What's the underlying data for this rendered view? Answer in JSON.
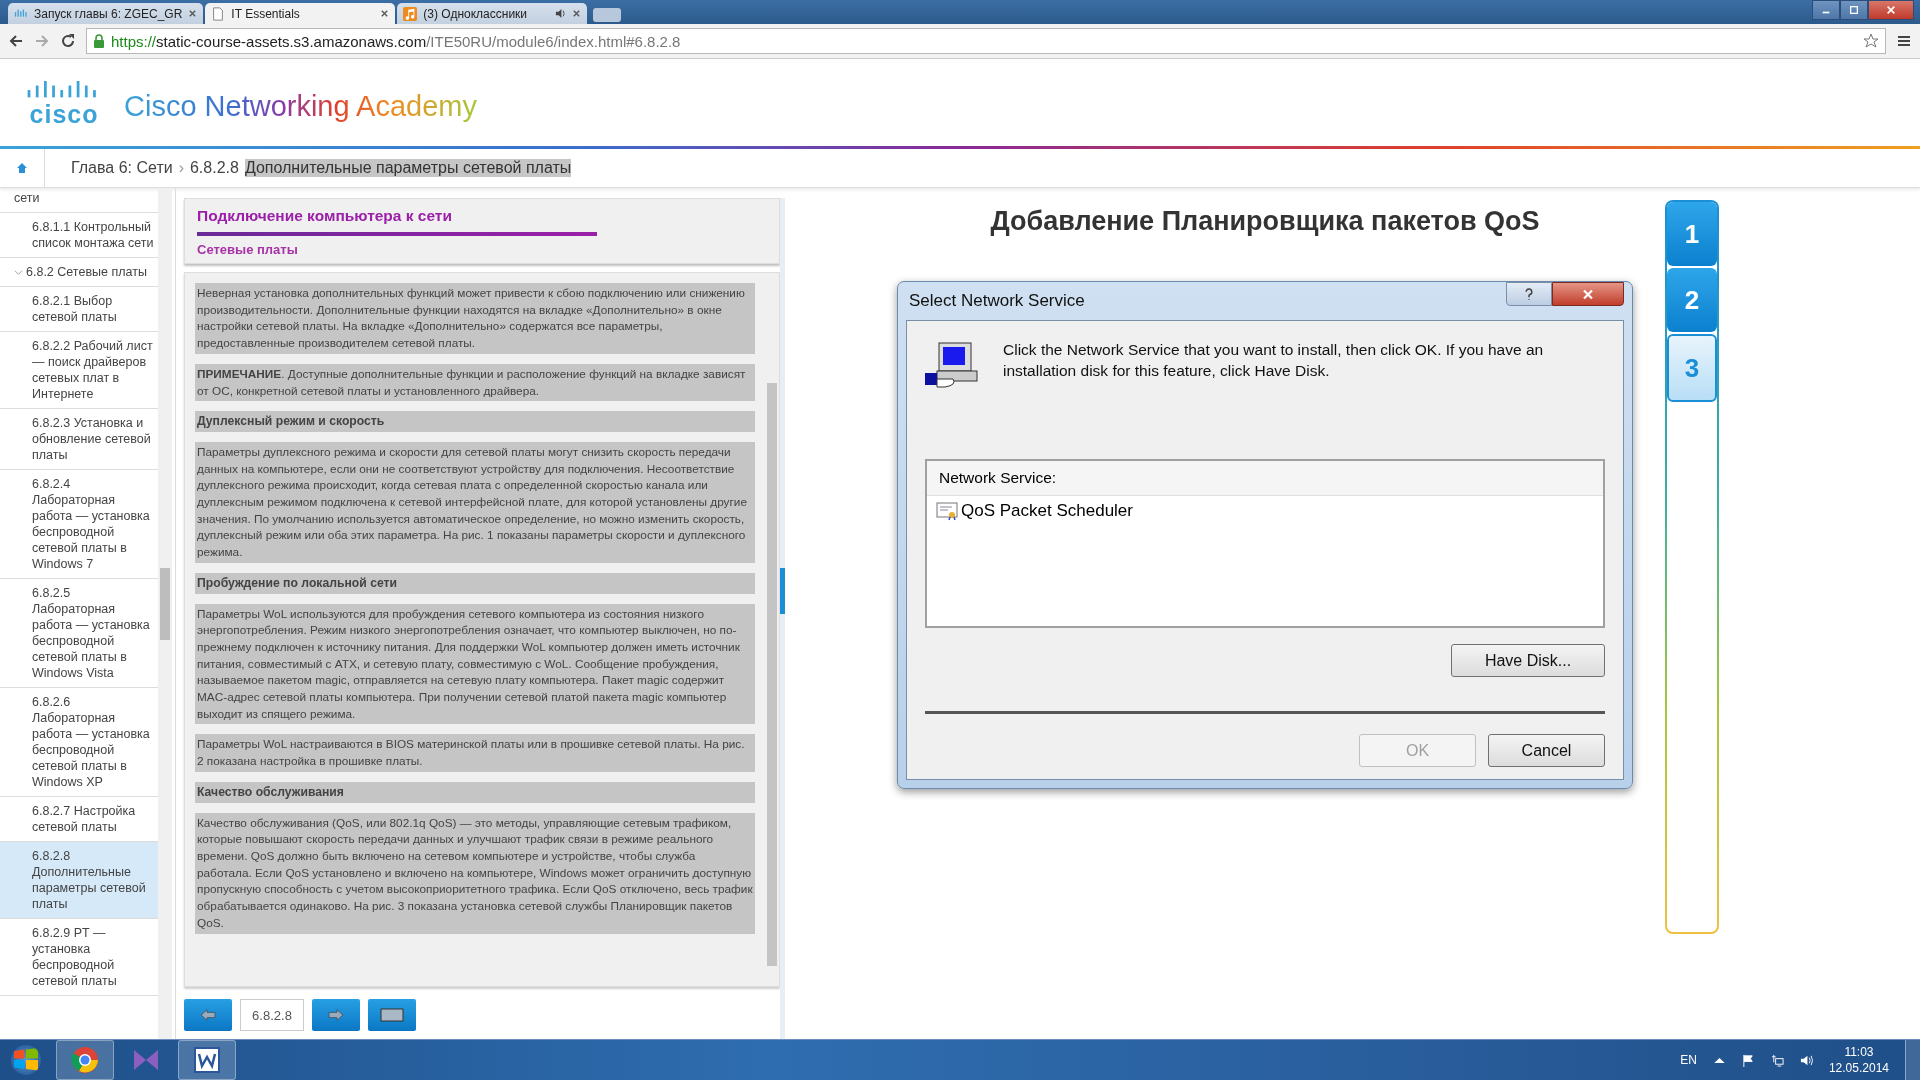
{
  "browser": {
    "tabs": [
      {
        "title": "Запуск главы 6: ZGEC_GR",
        "selected": false,
        "kind": "cisco",
        "audio": false
      },
      {
        "title": "IT Essentials",
        "selected": true,
        "kind": "page",
        "audio": false
      },
      {
        "title": "(3) Одноклассники",
        "selected": false,
        "kind": "music",
        "audio": true
      }
    ],
    "url_secure": "https://",
    "url_host": "static-course-assets.s3.amazonaws.com",
    "url_path": "/ITE50RU/module6/index.html#6.8.2.8"
  },
  "header": {
    "logo_wordmark": "cisco",
    "brand": "Cisco Networking Academy"
  },
  "breadcrumb": {
    "items": [
      {
        "label": "Глава 6: Сети",
        "highlighted": false
      },
      {
        "label": "6.8.2.8",
        "highlighted": false
      },
      {
        "label": "Дополнительные параметры сетевой платы",
        "highlighted": true
      }
    ],
    "separator": "›"
  },
  "sidebar": {
    "items": [
      {
        "label": "сети",
        "selected": false,
        "children": [
          {
            "label": "6.8.1.1 Контрольный список монтажа сети",
            "selected": false
          }
        ]
      },
      {
        "label": "6.8.2 Сетевые платы",
        "selected": false,
        "expanded": true,
        "children": [
          {
            "label": "6.8.2.1 Выбор сетевой платы",
            "selected": false
          },
          {
            "label": "6.8.2.2 Рабочий лист — поиск драйверов сетевых плат в Интернете",
            "selected": false
          },
          {
            "label": "6.8.2.3 Установка и обновление сетевой платы",
            "selected": false
          },
          {
            "label": "6.8.2.4 Лабораторная работа — установка беспроводной сетевой платы в Windows 7",
            "selected": false
          },
          {
            "label": "6.8.2.5 Лабораторная работа — установка беспроводной сетевой платы в Windows Vista",
            "selected": false
          },
          {
            "label": "6.8.2.6 Лабораторная работа — установка беспроводной сетевой платы в Windows XP",
            "selected": false
          },
          {
            "label": "6.8.2.7 Настройка сетевой платы",
            "selected": false
          },
          {
            "label": "6.8.2.8 Дополнительные параметры сетевой платы",
            "selected": true
          },
          {
            "label": "6.8.2.9 PT — установка беспроводной сетевой платы",
            "selected": false
          }
        ]
      }
    ]
  },
  "lesson": {
    "title": "Подключение компьютера к сети",
    "subtitle": "Сетевые платы",
    "blocks": [
      {
        "kind": "paragraph",
        "text": "Неверная установка дополнительных функций может привести к сбою подключению или снижению производительности. Дополнительные функции находятся на вкладке «Дополнительно» в окне настройки сетевой платы. На вкладке «Дополнительно» содержатся все параметры, предоставленные производителем сетевой платы."
      },
      {
        "kind": "paragraph",
        "text": "**ПРИМЕЧАНИЕ**. Доступные дополнительные функции и расположение функций на вкладке зависят от ОС, конкретной сетевой платы и установленного драйвера."
      },
      {
        "kind": "heading",
        "text": "Дуплексный режим и скорость"
      },
      {
        "kind": "paragraph",
        "text": "Параметры дуплексного режима и скорости для сетевой платы могут снизить скорость передачи данных на компьютере, если они не соответствуют устройству для подключения. Несоответствие дуплексного режима происходит, когда сетевая плата с определенной скоростью канала или дуплексным режимом подключена к сетевой интерфейсной плате, для которой установлены другие значения. По умолчанию используется автоматическое определение, но можно изменить скорость, дуплексный режим или оба этих параметра. На рис. 1 показаны параметры скорости и дуплексного режима."
      },
      {
        "kind": "heading",
        "text": "Пробуждение по локальной сети"
      },
      {
        "kind": "paragraph",
        "text": "Параметры WoL используются для пробуждения сетевого компьютера из состояния низкого энергопотребления. Режим низкого энергопотребления означает, что компьютер выключен, но по-прежнему подключен к источнику питания. Для поддержки WoL компьютер должен иметь источник питания, совместимый с ATX, и сетевую плату, совместимую с WoL. Сообщение пробуждения, называемое пакетом magic, отправляется на сетевую плату компьютера. Пакет magic содержит MAC-адрес сетевой платы компьютера. При получении сетевой платой пакета magic компьютер выходит из спящего режима."
      },
      {
        "kind": "paragraph",
        "text": "Параметры WoL настраиваются в BIOS материнской платы или в прошивке сетевой платы. На рис. 2 показана настройка в прошивке платы."
      },
      {
        "kind": "heading",
        "text": "Качество обслуживания"
      },
      {
        "kind": "paragraph",
        "text": "Качество обслуживания (QoS, или 802.1q QoS) — это методы, управляющие сетевым трафиком, которые повышают скорость передачи данных и улучшают трафик связи в режиме реального времени. QoS должно быть включено на сетевом компьютере и устройстве, чтобы служба работала. Если QoS установлено и включено на компьютере, Windows может ограничить доступную пропускную способность с учетом высокоприоритетного трафика. Если QoS отключено, весь трафик обрабатывается одинаково. На рис. 3 показана установка сетевой службы Планировщик пакетов QoS."
      }
    ],
    "page_number": "6.8.2.8"
  },
  "figure": {
    "title": "Добавление Планировщика пакетов QoS",
    "dialog": {
      "title": "Select Network Service",
      "instruction": "Click the Network Service that you want to install, then click OK. If you have an installation disk for this feature, click Have Disk.",
      "list_header": "Network Service:",
      "list_items": [
        {
          "label": "QoS Packet Scheduler",
          "selected": false
        }
      ],
      "have_disk": "Have Disk...",
      "ok": {
        "label": "OK",
        "disabled": true
      },
      "cancel": {
        "label": "Cancel",
        "disabled": false
      }
    },
    "steps": [
      {
        "label": "1",
        "selected": false
      },
      {
        "label": "2",
        "selected": false
      },
      {
        "label": "3",
        "selected": true
      }
    ]
  },
  "taskbar": {
    "language": "EN",
    "time": "11:03",
    "date": "12.05.2014"
  }
}
